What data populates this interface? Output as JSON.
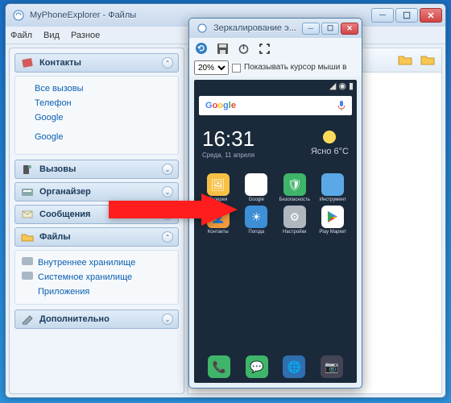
{
  "main": {
    "title": "MyPhoneExplorer -  Файлы",
    "menu": [
      "Файл",
      "Вид",
      "Разное"
    ]
  },
  "sidebar": {
    "contacts": {
      "label": "Контакты",
      "items": [
        "Все вызовы",
        "Телефон",
        "Google",
        "",
        "Google",
        ""
      ]
    },
    "calls": {
      "label": "Вызовы"
    },
    "organizer": {
      "label": "Органайзер"
    },
    "messages": {
      "label": "Сообщения"
    },
    "files": {
      "label": "Файлы",
      "items": [
        "Внутреннее хранилище",
        "Системное хранилище",
        "Приложения"
      ]
    },
    "extra": {
      "label": "Дополнительно"
    }
  },
  "mirror": {
    "title": "Зеркалирование э...",
    "zoom": "20%",
    "checkbox_label": "Показывать курсор мыши в"
  },
  "phone": {
    "time": "16:31",
    "date": "Среда, 11 апреля",
    "weather": {
      "cond": "Ясно",
      "temp": "6°C"
    },
    "search": "Google",
    "apps_row1": [
      {
        "name": "Галерея",
        "bg": "#f8c146"
      },
      {
        "name": "Google",
        "bg": "#ffffff"
      },
      {
        "name": "Безопасность",
        "bg": "#3fb56a"
      },
      {
        "name": "Инструмент",
        "bg": "#5aa9e6"
      }
    ],
    "apps_row2": [
      {
        "name": "Контакты",
        "bg": "#f29b3a"
      },
      {
        "name": "Погода",
        "bg": "#3d8fd6"
      },
      {
        "name": "Настройки",
        "bg": "#b0b7bf"
      },
      {
        "name": "Play Маркет",
        "bg": "#ffffff"
      }
    ],
    "dock": [
      {
        "name": "phone",
        "bg": "#3fb56a"
      },
      {
        "name": "sms",
        "bg": "#3fb56a"
      },
      {
        "name": "browser",
        "bg": "#2f6fb0"
      },
      {
        "name": "camera",
        "bg": "#445"
      }
    ]
  }
}
